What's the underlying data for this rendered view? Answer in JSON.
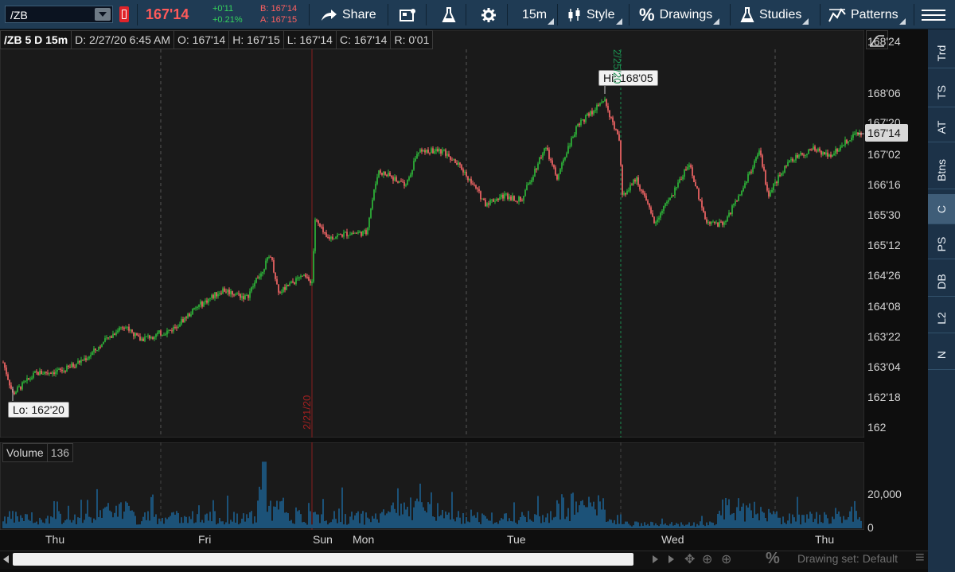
{
  "toolbar": {
    "symbol": "/ZB",
    "last_price": "167'14",
    "net_change": "+0'11",
    "pct_change": "+0.21%",
    "bid": "B: 167'14",
    "ask": "A: 167'15",
    "share_label": "Share",
    "timeframe_label": "15m",
    "style_label": "Style",
    "drawings_label": "Drawings",
    "studies_label": "Studies",
    "patterns_label": "Patterns"
  },
  "chart_header": {
    "symbol_period": "/ZB 5 D 15m",
    "date": "D: 2/27/20 6:45 AM",
    "open": "O: 167'14",
    "high": "H: 167'15",
    "low": "L: 167'14",
    "close": "C: 167'14",
    "range": "R: 0'01"
  },
  "price_axis": [
    "168'24",
    "168'06",
    "167'20",
    "167'02",
    "166'16",
    "165'30",
    "165'12",
    "164'26",
    "164'08",
    "163'22",
    "163'04",
    "162'18",
    "162"
  ],
  "current_price_badge": "167'14",
  "callouts": {
    "high": "Hi: 168'05",
    "low": "Lo: 162'20"
  },
  "session_dates": {
    "red": "2/21/20",
    "green": "2/25/20"
  },
  "volume": {
    "label": "Volume",
    "value": "136",
    "axis": [
      "20,000",
      "0"
    ]
  },
  "time_axis": [
    "Thu",
    "Fri",
    "Sun",
    "Mon",
    "Tue",
    "Wed",
    "Thu"
  ],
  "drawing_set": "Drawing set: Default",
  "sidebar_tabs": [
    "Trd",
    "TS",
    "AT",
    "Btns",
    "C",
    "PS",
    "DB",
    "L2",
    "N"
  ],
  "chart_data": {
    "type": "candlestick",
    "symbol": "/ZB",
    "aggregation": "15m",
    "range": "5 D",
    "price_axis_ticks": [
      "162",
      "162'18",
      "163'04",
      "163'22",
      "164'08",
      "164'26",
      "165'12",
      "165'30",
      "166'16",
      "167'02",
      "167'20",
      "168'06",
      "168'24"
    ],
    "high": "168'05",
    "low": "162'20",
    "last": "167'14",
    "sessions": [
      "Thu",
      "Fri",
      "Sun",
      "Mon",
      "Tue",
      "Wed",
      "Thu"
    ],
    "colors": {
      "up": "#2fbf3a",
      "down": "#ff6a6a",
      "volume": "#1e6aa0",
      "background": "#1a1a1a"
    }
  }
}
